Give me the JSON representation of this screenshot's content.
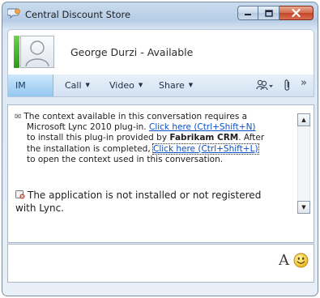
{
  "window": {
    "title": "Central Discount Store",
    "controls": {
      "minimize": "minimize-icon",
      "maximize": "maximize-icon",
      "close": "close-icon"
    }
  },
  "contact": {
    "name_status": "George Durzi - Available",
    "presence_color": "#3cb22a"
  },
  "toolbar": {
    "im_label": "IM",
    "call_label": "Call",
    "video_label": "Video",
    "share_label": "Share",
    "people_icon": "people-options-icon",
    "attach_icon": "paperclip-icon",
    "overflow_label": "»"
  },
  "conversation": {
    "plugin_message": {
      "line1": "The context available in this conversation requires a",
      "line2_prefix": "Microsoft Lync 2010 plug-in. ",
      "link1": "Click here (Ctrl+Shift+N)",
      "line3_prefix": "to install this plug-in provided by ",
      "provider": "Fabrikam CRM",
      "line3_suffix": ". After",
      "line4_prefix": "the installation is completed, ",
      "link2": "Click here (Ctrl+Shift+L)",
      "line5": "to open the context used in this conversation."
    },
    "error_message": {
      "line1": "The application is not installed or not registered",
      "line2": "with Lync."
    }
  },
  "input": {
    "font_label": "A",
    "emoticon_icon": "smiley-icon"
  },
  "colors": {
    "accent": "#94c7f0",
    "link": "#0a50c8",
    "close_button": "#c2452a"
  }
}
